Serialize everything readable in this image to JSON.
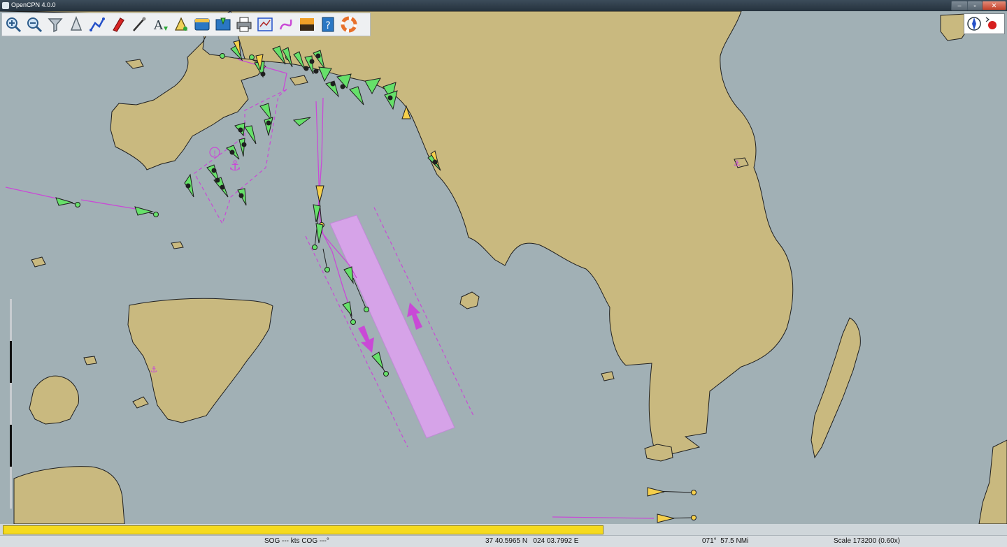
{
  "window": {
    "title": "OpenCPN 4.0.0",
    "min_glyph": "–",
    "max_glyph": "▫",
    "close_glyph": "✕"
  },
  "toolbar": {
    "items": [
      {
        "name": "zoom-in-icon"
      },
      {
        "name": "zoom-out-icon"
      },
      {
        "name": "quilt-funnel-icon"
      },
      {
        "name": "chart-scale-icon"
      },
      {
        "name": "route-icon"
      },
      {
        "name": "ownship-track-icon"
      },
      {
        "name": "measure-tool-icon"
      },
      {
        "name": "text-toggle-icon"
      },
      {
        "name": "waypoint-icon"
      },
      {
        "name": "route-manager-icon"
      },
      {
        "name": "ais-target-list-icon"
      },
      {
        "name": "print-icon"
      },
      {
        "name": "options-icon"
      },
      {
        "name": "track-icon"
      },
      {
        "name": "color-scheme-icon"
      },
      {
        "name": "help-icon"
      },
      {
        "name": "mob-lifebuoy-icon"
      }
    ]
  },
  "status": {
    "sog_cog": "SOG --- kts COG ---°",
    "position": "37 40.5965 N   024 03.7992 E",
    "bearing": "071°  57.5 NMi",
    "scale": "Scale 173200 (0.60x)"
  },
  "progress": {
    "fraction": 0.595
  },
  "colors": {
    "sea": "#a1b0b5",
    "land": "#c9b97f",
    "coast": "#1f1f1f",
    "ais_active": "#66e06a",
    "ais_class_b": "#f5cf4b",
    "tss_lane": "#d6a3e8",
    "route": "#c94ad6"
  }
}
